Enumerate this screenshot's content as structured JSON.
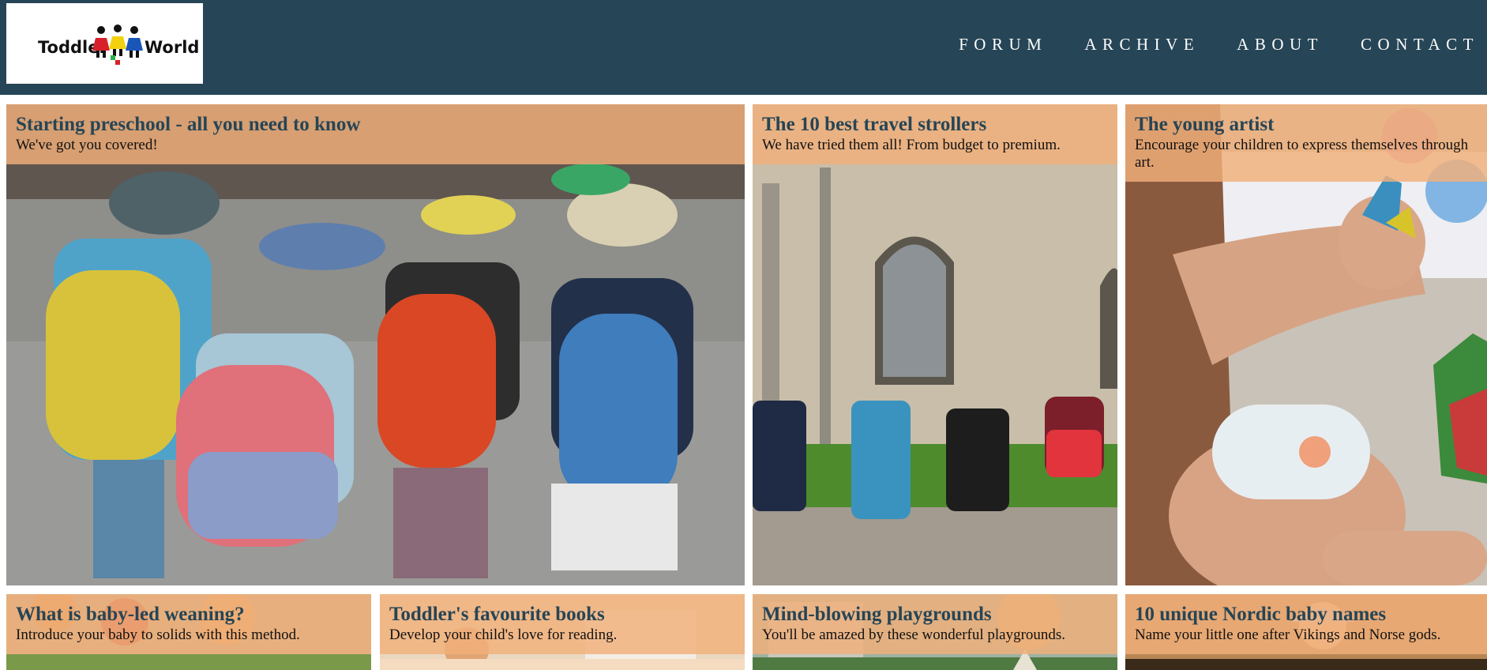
{
  "logo": {
    "text_left": "Toddler",
    "text_right": "World"
  },
  "nav": [
    "FORUM",
    "ARCHIVE",
    "ABOUT",
    "CONTACT"
  ],
  "cards": [
    {
      "title": "Starting preschool - all you need to know",
      "subtitle": "We've got you covered!"
    },
    {
      "title": "The 10 best travel strollers",
      "subtitle": "We have tried them all! From budget to premium."
    },
    {
      "title": "The young artist",
      "subtitle": "Encourage your children to express themselves through art."
    },
    {
      "title": "What is baby-led weaning?",
      "subtitle": "Introduce your baby to solids with this method."
    },
    {
      "title": "Toddler's favourite books",
      "subtitle": "Develop your child's love for reading."
    },
    {
      "title": "Mind-blowing playgrounds",
      "subtitle": "You'll be amazed by these wonderful playgrounds."
    },
    {
      "title": "10 unique Nordic baby names",
      "subtitle": "Name your little one after Vikings and Norse gods."
    }
  ],
  "colors": {
    "header": "#264556",
    "caption": "#f1b07a",
    "title": "#264556"
  }
}
